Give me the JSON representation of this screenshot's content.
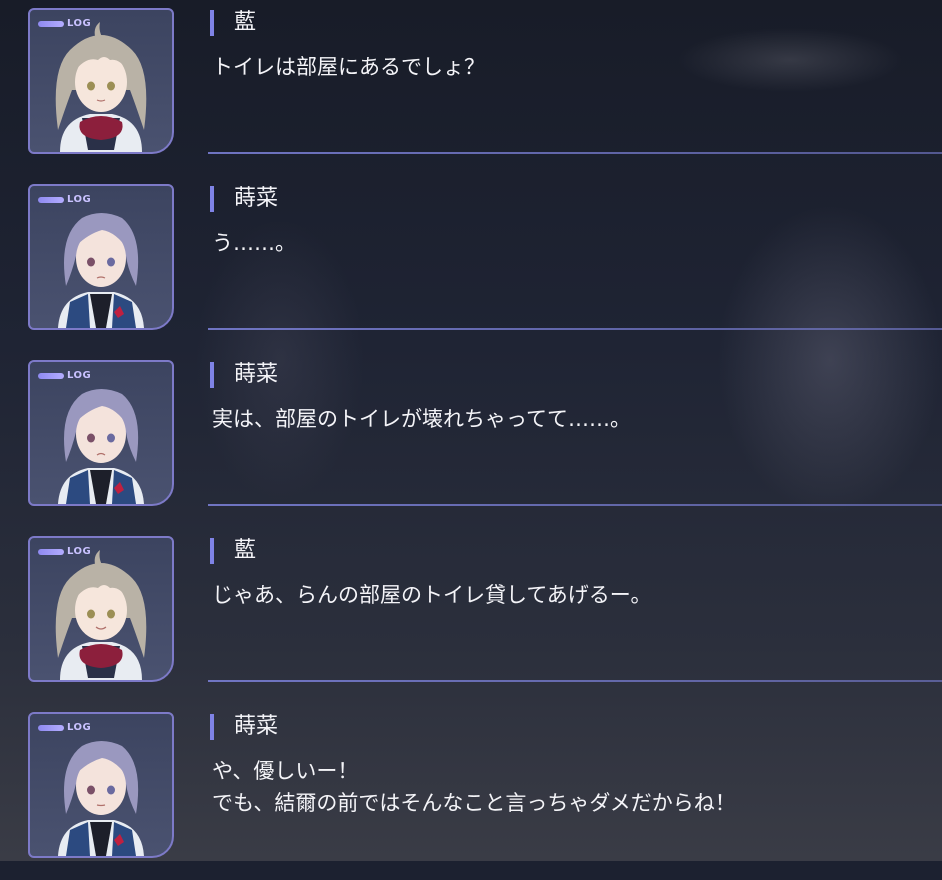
{
  "log": {
    "tag_label": "LOG",
    "entries": [
      {
        "speaker": "藍",
        "character": "ai",
        "lines": [
          "トイレは部屋にあるでしょ？"
        ]
      },
      {
        "speaker": "蒔菜",
        "character": "makina",
        "lines": [
          "う……。"
        ]
      },
      {
        "speaker": "蒔菜",
        "character": "makina",
        "lines": [
          "実は、部屋のトイレが壊れちゃってて……。"
        ]
      },
      {
        "speaker": "藍",
        "character": "ai",
        "lines": [
          "じゃあ、らんの部屋のトイレ貸してあげるー。"
        ]
      },
      {
        "speaker": "蒔菜",
        "character": "makina",
        "lines": [
          "や、優しいー！",
          "でも、結爾の前ではそんなこと言っちゃダメだからね！"
        ]
      }
    ]
  },
  "colors": {
    "accent": "#7f83e6",
    "text": "#f4f4f8",
    "hair_ai": "#b9b2a6",
    "hair_makina": "#9a98bf",
    "ribbon": "#8c1f3c"
  }
}
